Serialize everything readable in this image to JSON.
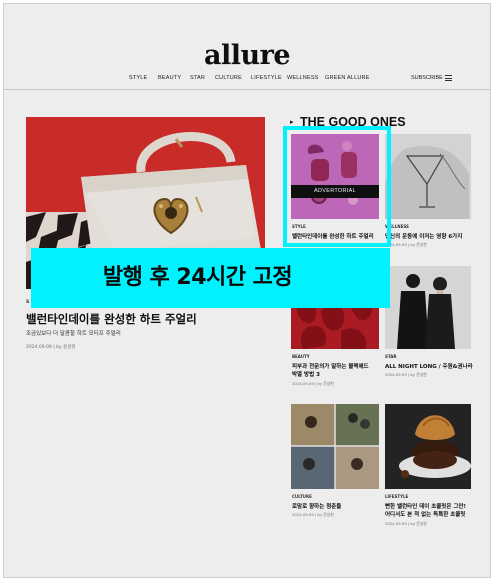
{
  "header": {
    "logo": "allure",
    "nav": [
      "STYLE",
      "BEAUTY",
      "STAR",
      "CULTURE",
      "LIFESTYLE",
      "WELLNESS",
      "GREEN ALLURE"
    ],
    "subscribe": "SUBSCRIBE"
  },
  "hero": {
    "category": "S",
    "title": "밸런타인데이를 완성한 하트 주얼리",
    "subtitle": "조금있보다 더 달콤할 하트 모티프 주얼리",
    "meta": "2024.09.09 | by 윤성현"
  },
  "section": {
    "title": "THE GOOD ONES"
  },
  "cards": [
    {
      "category": "STYLE",
      "title": "밸런타인데이를 완성한 하트 주얼리",
      "meta": "",
      "badge": "ADVERTORIAL"
    },
    {
      "category": "WELLNESS",
      "title": "당신의 운동에 이저는 영향 6가지",
      "meta": "2024.09.09 | by 윤성현",
      "badge": ""
    },
    {
      "category": "BEAUTY",
      "title": "피부과 전문의가 말하는 블랙헤드",
      "title2": "박멸 방법 3",
      "meta": "2024.09.09 | by 윤성현",
      "badge": ""
    },
    {
      "category": "STAR",
      "title": "ALL NIGHT LONG / 주원&권나라",
      "meta": "2024.09.09 | by 윤성현",
      "badge": ""
    },
    {
      "category": "CULTURE",
      "title": "로맘로 향하는 청춘들",
      "meta": "2024.09.09 | by 윤성현",
      "badge": ""
    },
    {
      "category": "LIFESTYLE",
      "title": "뻔한 밸런타인 데이 초콜릿은 그만!",
      "title2": "어디서도 본 적 없는 독특한 초콜릿",
      "meta": "2024.09.09 | by 윤성현",
      "badge": ""
    }
  ],
  "overlay": {
    "banner_text": "발행 후 24시간 고정"
  },
  "colors": {
    "highlight": "#00f2ff",
    "hero_bg": "#d9302c",
    "ad_tint": "#c96fc5"
  }
}
